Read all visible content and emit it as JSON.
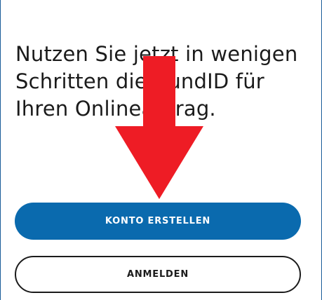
{
  "intro": {
    "line1": "Nutzen Sie jetzt in wenigen",
    "line2": "Schritten die BundID für",
    "line3": "Ihren Onlineantrag."
  },
  "buttons": {
    "create_account_label": "KONTO ERSTELLEN",
    "login_label": "ANMELDEN"
  },
  "colors": {
    "primary": "#0a6aae",
    "text": "#1b1b1b",
    "annotation_arrow": "#ee1c25"
  },
  "annotation": {
    "icon": "red-down-arrow-icon"
  }
}
